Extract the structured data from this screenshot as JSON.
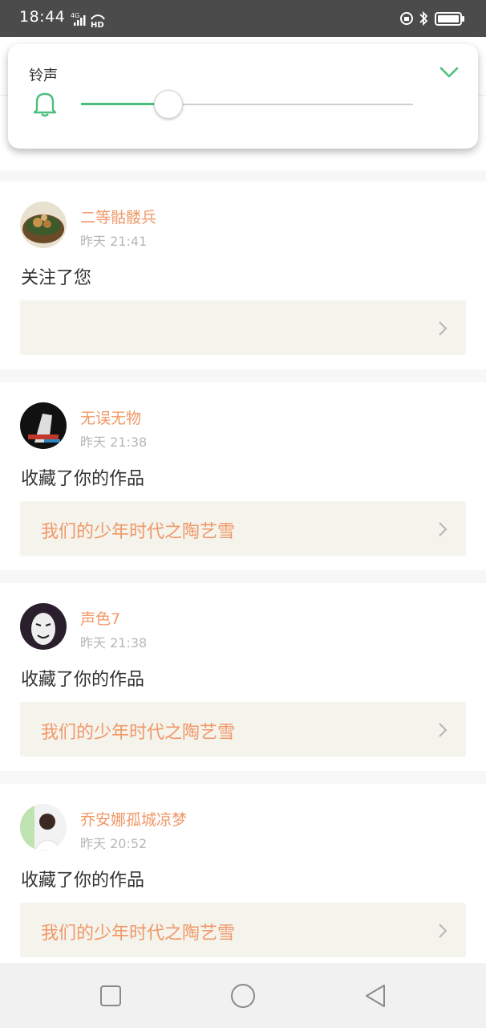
{
  "status_bar": {
    "time": "18:44",
    "network": "4G",
    "hd": "HD",
    "icons": [
      "signal-icon",
      "alarm-icon",
      "bluetooth-icon",
      "battery-icon"
    ]
  },
  "volume_popup": {
    "label": "铃声",
    "level_percent": 26,
    "accent_color": "#4cbf7e"
  },
  "notifications": [
    {
      "username": "二等骷髅兵",
      "time": "昨天 21:41",
      "action": "关注了您",
      "work_title": ""
    },
    {
      "username": "无误无物",
      "time": "昨天 21:38",
      "action": "收藏了你的作品",
      "work_title": "我们的少年时代之陶艺雪"
    },
    {
      "username": "声色7",
      "time": "昨天 21:38",
      "action": "收藏了你的作品",
      "work_title": "我们的少年时代之陶艺雪"
    },
    {
      "username": "乔安娜孤城凉梦",
      "time": "昨天 20:52",
      "action": "收藏了你的作品",
      "work_title": "我们的少年时代之陶艺雪"
    }
  ],
  "colors": {
    "username": "#f09868",
    "link_background": "#f4f3ec",
    "time": "#b6b6b6"
  },
  "navbar": {
    "buttons": [
      "recent-apps-icon",
      "home-icon",
      "back-icon"
    ]
  }
}
